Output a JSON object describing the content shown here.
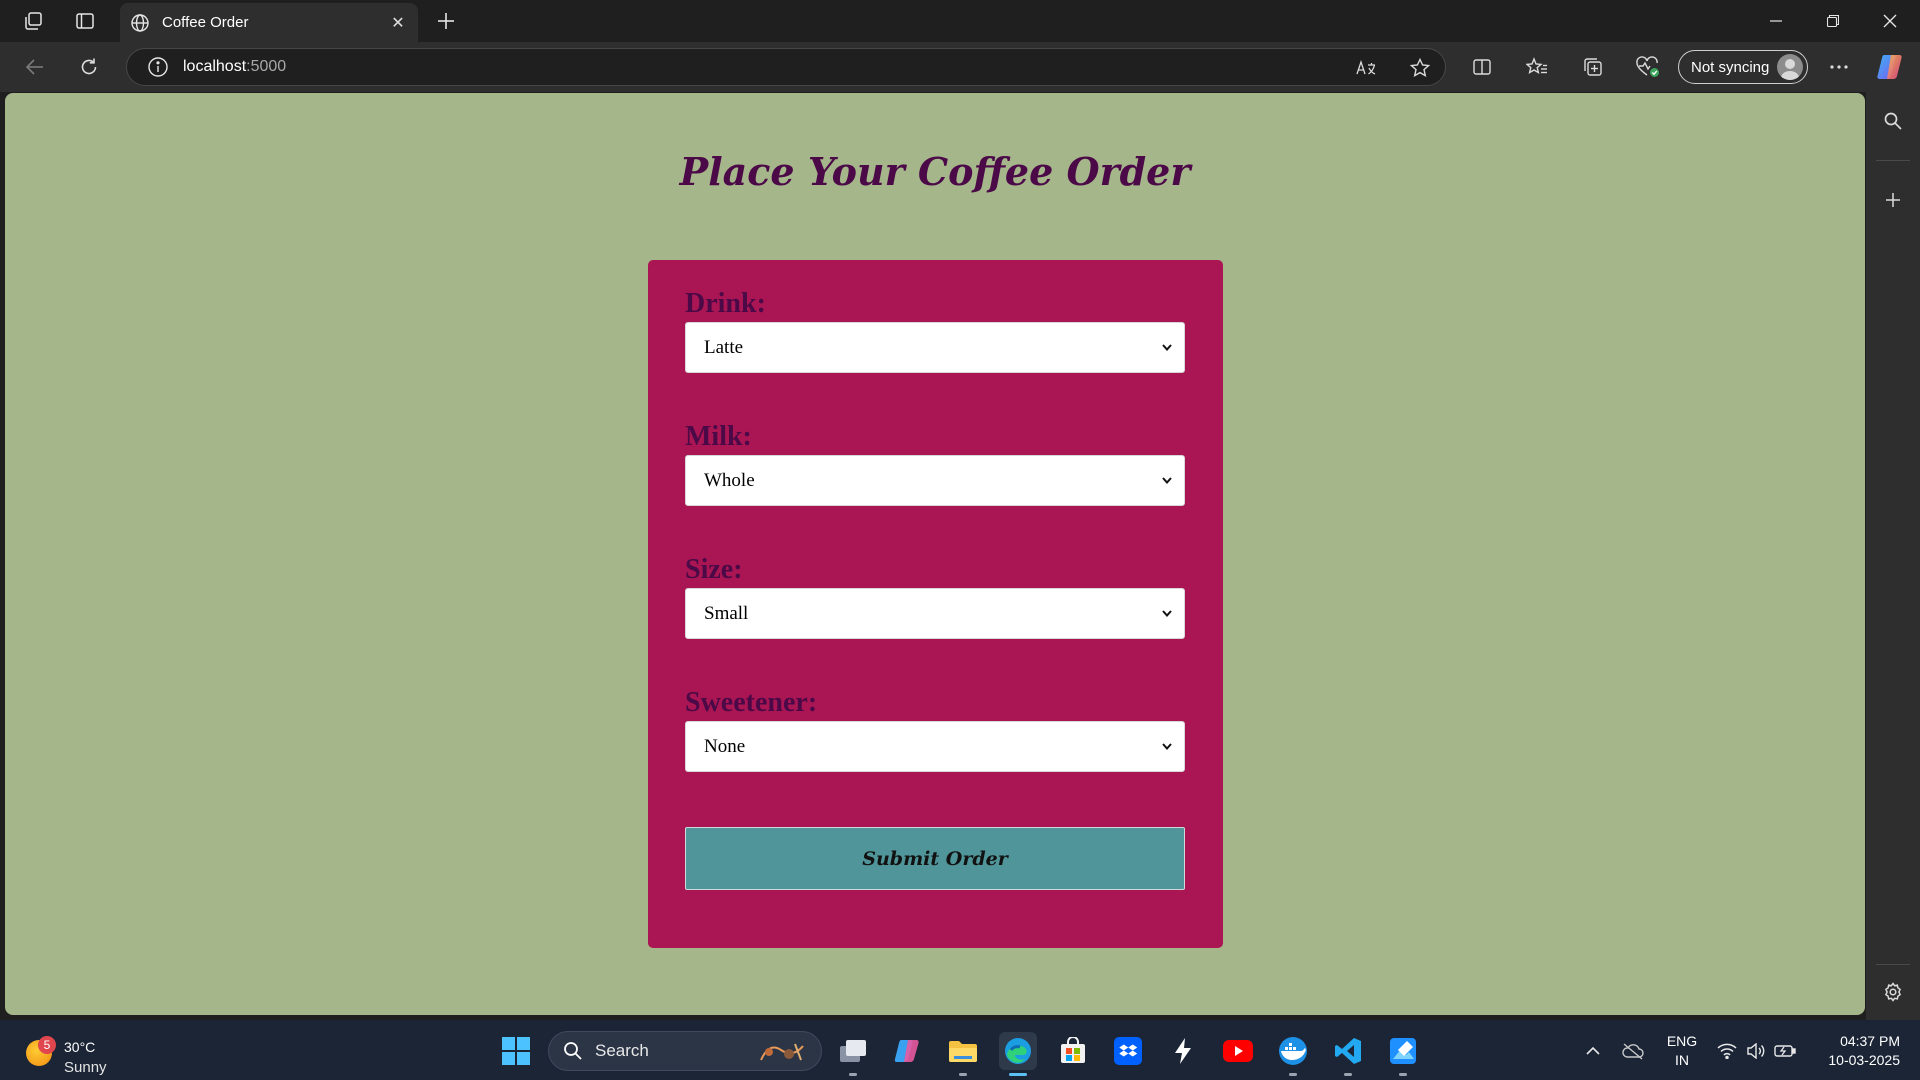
{
  "browser": {
    "tab_title": "Coffee Order",
    "url_host": "localhost",
    "url_port": ":5000",
    "sync_label": "Not syncing"
  },
  "page": {
    "title": "Place Your Coffee Order",
    "fields": [
      {
        "label": "Drink:",
        "value": "Latte"
      },
      {
        "label": "Milk:",
        "value": "Whole"
      },
      {
        "label": "Size:",
        "value": "Small"
      },
      {
        "label": "Sweetener:",
        "value": "None"
      }
    ],
    "submit_label": "Submit Order"
  },
  "colors": {
    "page_background": "#a6b68b",
    "card_background": "#aa1653",
    "heading_text": "#4b0a47",
    "button_background": "#4f959a"
  },
  "taskbar": {
    "weather_badge": "5",
    "temperature": "30°C",
    "condition": "Sunny",
    "search_label": "Search",
    "lang_top": "ENG",
    "lang_bottom": "IN",
    "time": "04:37 PM",
    "date": "10-03-2025"
  },
  "icons": {
    "titlebar": [
      "workspaces-icon",
      "tab-actions-icon",
      "globe-icon",
      "close-tab-icon",
      "new-tab-icon",
      "minimize-icon",
      "restore-icon",
      "close-window-icon"
    ],
    "toolbar": [
      "back-icon",
      "refresh-icon",
      "info-icon",
      "read-aloud-icon",
      "favorite-star-icon",
      "split-screen-icon",
      "favorites-icon",
      "collections-icon",
      "browser-essentials-icon",
      "more-icon",
      "copilot-icon"
    ],
    "sidebar": [
      "search-icon",
      "add-icon",
      "settings-icon"
    ],
    "taskbar_apps": [
      "task-view-icon",
      "copilot-app-icon",
      "file-explorer-icon",
      "edge-icon",
      "store-icon",
      "dropbox-icon",
      "cursor-icon",
      "youtube-icon",
      "docker-icon",
      "vscode-icon",
      "paint-icon"
    ]
  }
}
